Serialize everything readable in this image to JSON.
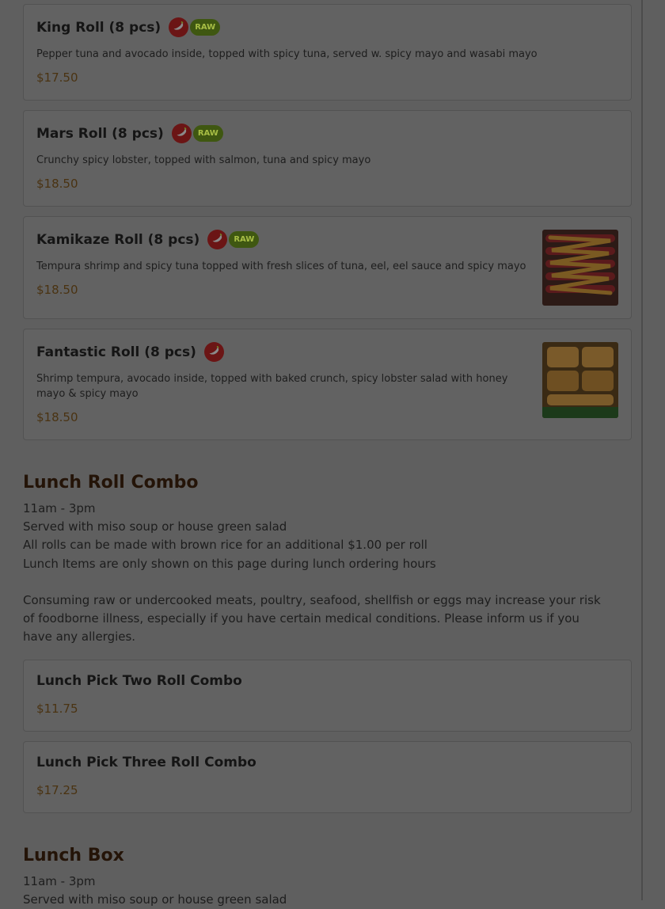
{
  "items": [
    {
      "name": "King Roll (8 pcs)",
      "spicy": true,
      "raw_badge": "RAW",
      "description": "Pepper tuna and avocado inside, topped with spicy tuna, served w. spicy mayo and wasabi mayo",
      "price": "$17.50"
    },
    {
      "name": "Mars Roll (8 pcs)",
      "spicy": true,
      "raw_badge": "RAW",
      "description": "Crunchy spicy lobster, topped with salmon, tuna and spicy mayo",
      "price": "$18.50"
    },
    {
      "name": "Kamikaze Roll (8 pcs)",
      "spicy": true,
      "raw_badge": "RAW",
      "description": "Tempura shrimp and spicy tuna topped with fresh slices of tuna, eel, eel sauce and spicy mayo",
      "price": "$18.50"
    },
    {
      "name": "Fantastic Roll (8 pcs)",
      "spicy": true,
      "description": "Shrimp tempura, avocado inside, topped with baked crunch, spicy lobster salad with honey mayo & spicy mayo",
      "price": "$18.50"
    }
  ],
  "lunch_roll_combo": {
    "title": "Lunch Roll Combo",
    "hours": "11am - 3pm",
    "line1": "Served with miso soup or house green salad",
    "line2": "All rolls can be made with brown rice for an additional $1.00 per roll",
    "line3": "Lunch Items are only shown on this page during lunch ordering hours",
    "warning": "Consuming raw or undercooked meats, poultry, seafood, shellfish or eggs may increase your risk of foodborne illness, especially if you have certain medical conditions. Please inform us if you have any allergies.",
    "items": [
      {
        "name": "Lunch Pick Two Roll Combo",
        "price": "$11.75"
      },
      {
        "name": "Lunch Pick Three Roll Combo",
        "price": "$17.25"
      }
    ]
  },
  "lunch_box": {
    "title": "Lunch Box",
    "hours": "11am - 3pm",
    "line1": "Served with miso soup or house green salad"
  },
  "colors": {
    "overlay": "#5f5f5f",
    "chili": "#6b1515",
    "raw_badge": "#3f5711",
    "price": "#4a3312"
  }
}
